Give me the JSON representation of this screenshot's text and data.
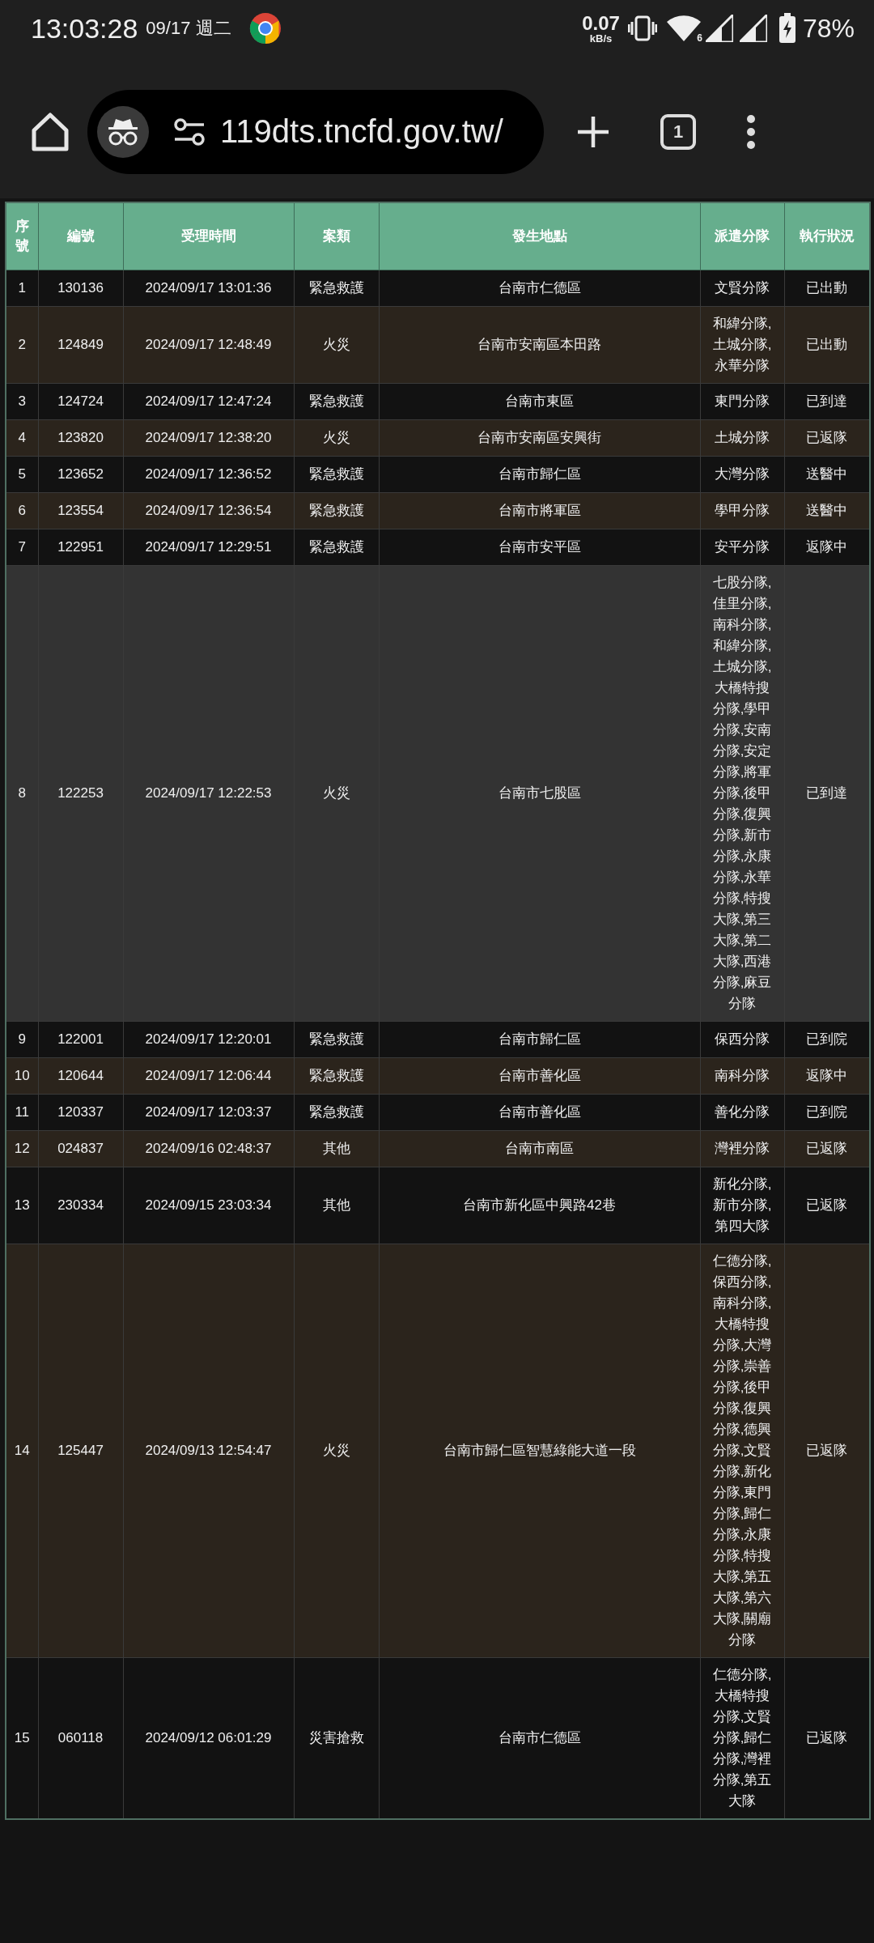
{
  "status_bar": {
    "time": "13:03:28",
    "date": "09/17 週二",
    "speed": "0.07",
    "speed_unit": "kB/s",
    "wifi_badge": "6",
    "battery": "78%"
  },
  "browser": {
    "url": "119dts.tncfd.gov.tw/",
    "tab_count": "1"
  },
  "table": {
    "columns": [
      "序號",
      "編號",
      "受理時間",
      "案類",
      "發生地點",
      "派遣分隊",
      "執行狀況"
    ],
    "rows": [
      {
        "index": "1",
        "id": "130136",
        "time": "2024/09/17 13:01:36",
        "type": "緊急救護",
        "location": "台南市仁德區",
        "units": "文賢分隊",
        "status": "已出動",
        "selected": false
      },
      {
        "index": "2",
        "id": "124849",
        "time": "2024/09/17 12:48:49",
        "type": "火災",
        "location": "台南市安南區本田路",
        "units": "和緯分隊,土城分隊,永華分隊",
        "status": "已出動",
        "selected": false
      },
      {
        "index": "3",
        "id": "124724",
        "time": "2024/09/17 12:47:24",
        "type": "緊急救護",
        "location": "台南市東區",
        "units": "東門分隊",
        "status": "已到達",
        "selected": false
      },
      {
        "index": "4",
        "id": "123820",
        "time": "2024/09/17 12:38:20",
        "type": "火災",
        "location": "台南市安南區安興街",
        "units": "土城分隊",
        "status": "已返隊",
        "selected": false
      },
      {
        "index": "5",
        "id": "123652",
        "time": "2024/09/17 12:36:52",
        "type": "緊急救護",
        "location": "台南市歸仁區",
        "units": "大灣分隊",
        "status": "送醫中",
        "selected": false
      },
      {
        "index": "6",
        "id": "123554",
        "time": "2024/09/17 12:36:54",
        "type": "緊急救護",
        "location": "台南市將軍區",
        "units": "學甲分隊",
        "status": "送醫中",
        "selected": false
      },
      {
        "index": "7",
        "id": "122951",
        "time": "2024/09/17 12:29:51",
        "type": "緊急救護",
        "location": "台南市安平區",
        "units": "安平分隊",
        "status": "返隊中",
        "selected": false
      },
      {
        "index": "8",
        "id": "122253",
        "time": "2024/09/17 12:22:53",
        "type": "火災",
        "location": "台南市七股區",
        "units": "七股分隊,佳里分隊,南科分隊,和緯分隊,土城分隊,大橋特搜分隊,學甲分隊,安南分隊,安定分隊,將軍分隊,後甲分隊,復興分隊,新市分隊,永康分隊,永華分隊,特搜大隊,第三大隊,第二大隊,西港分隊,麻豆分隊",
        "status": "已到達",
        "selected": true
      },
      {
        "index": "9",
        "id": "122001",
        "time": "2024/09/17 12:20:01",
        "type": "緊急救護",
        "location": "台南市歸仁區",
        "units": "保西分隊",
        "status": "已到院",
        "selected": false
      },
      {
        "index": "10",
        "id": "120644",
        "time": "2024/09/17 12:06:44",
        "type": "緊急救護",
        "location": "台南市善化區",
        "units": "南科分隊",
        "status": "返隊中",
        "selected": false
      },
      {
        "index": "11",
        "id": "120337",
        "time": "2024/09/17 12:03:37",
        "type": "緊急救護",
        "location": "台南市善化區",
        "units": "善化分隊",
        "status": "已到院",
        "selected": false
      },
      {
        "index": "12",
        "id": "024837",
        "time": "2024/09/16 02:48:37",
        "type": "其他",
        "location": "台南市南區",
        "units": "灣裡分隊",
        "status": "已返隊",
        "selected": false
      },
      {
        "index": "13",
        "id": "230334",
        "time": "2024/09/15 23:03:34",
        "type": "其他",
        "location": "台南市新化區中興路42巷",
        "units": "新化分隊,新市分隊,第四大隊",
        "status": "已返隊",
        "selected": false
      },
      {
        "index": "14",
        "id": "125447",
        "time": "2024/09/13 12:54:47",
        "type": "火災",
        "location": "台南市歸仁區智慧綠能大道一段",
        "units": "仁德分隊,保西分隊,南科分隊,大橋特搜分隊,大灣分隊,崇善分隊,後甲分隊,復興分隊,德興分隊,文賢分隊,新化分隊,東門分隊,歸仁分隊,永康分隊,特搜大隊,第五大隊,第六大隊,關廟分隊",
        "status": "已返隊",
        "selected": false
      },
      {
        "index": "15",
        "id": "060118",
        "time": "2024/09/12 06:01:29",
        "type": "災害搶救",
        "location": "台南市仁德區",
        "units": "仁德分隊,大橋特搜分隊,文賢分隊,歸仁分隊,灣裡分隊,第五大隊",
        "status": "已返隊",
        "selected": false
      }
    ]
  }
}
